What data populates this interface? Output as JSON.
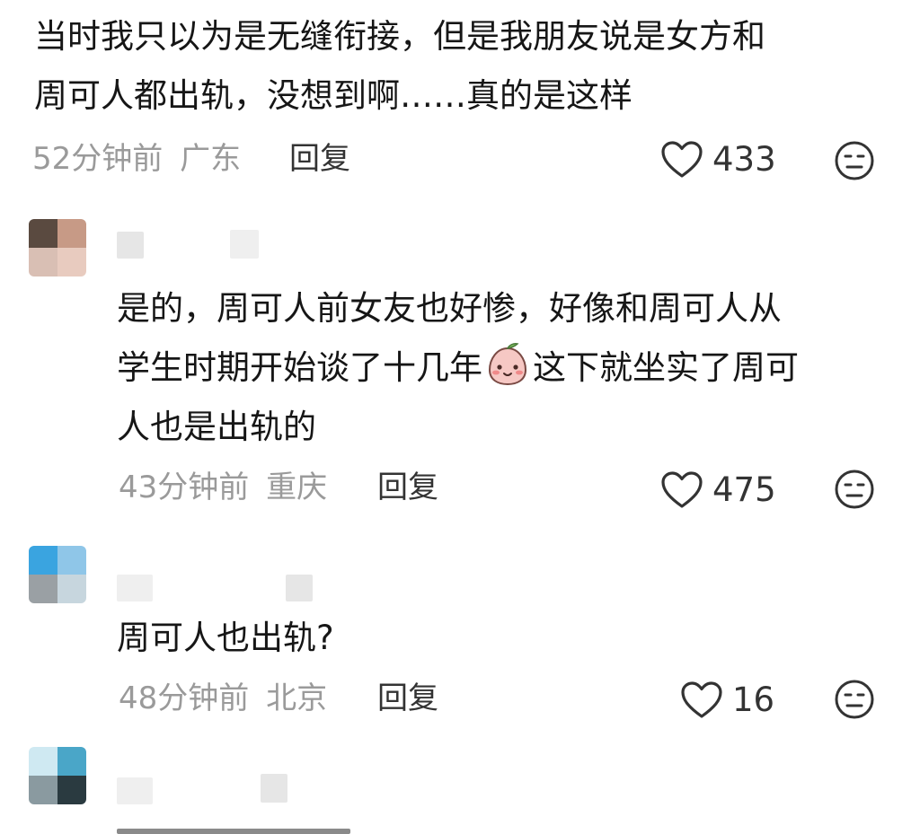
{
  "comments": [
    {
      "text_lines": [
        "当时我只以为是无缝衔接，但是我朋友说是女方和",
        "周可人都出轨，没想到啊……真的是这样"
      ],
      "time": "52分钟前",
      "location": "广东",
      "reply": "回复",
      "likes": "433"
    },
    {
      "text_lines": [
        "是的，周可人前女友也好惨，好像和周可人从",
        "学生时期开始谈了十几年",
        "这下就坐实了周可",
        "人也是出轨的"
      ],
      "time": "43分钟前",
      "location": "重庆",
      "reply": "回复",
      "likes": "475"
    },
    {
      "text_lines": [
        "周可人也出轨?"
      ],
      "time": "48分钟前",
      "location": "北京",
      "reply": "回复",
      "likes": "16"
    }
  ],
  "icons": {
    "like": "heart-outline-icon",
    "dislike": "meh-face-icon",
    "emoji": "peach-face-emoji"
  },
  "colors": {
    "meta": "#9a9a9a",
    "text": "#161616"
  }
}
